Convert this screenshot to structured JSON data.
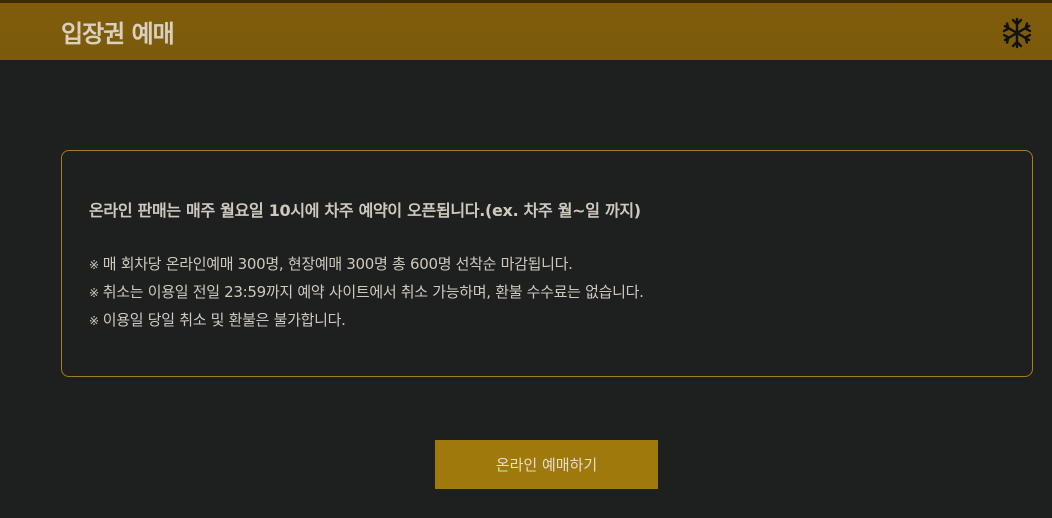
{
  "header": {
    "title": "입장권 예매",
    "icon": "snowflake-icon"
  },
  "notice": {
    "headline": "온라인 판매는 매주 월요일 10시에 차주 예약이 오픈됩니다.(ex. 차주 월~일 까지)",
    "bullet_mark": "※",
    "items": [
      "매 회차당 온라인예매 300명, 현장예매 300명 총 600명 선착순 마감됩니다.",
      "취소는 이용일 전일 23:59까지 예약 사이트에서 취소 가능하며, 환불 수수료는 없습니다.",
      "이용일 당일 취소 및 환불은 불가합니다."
    ]
  },
  "button": {
    "label": "온라인 예매하기"
  },
  "colors": {
    "header_bg": "#7f5d0d",
    "page_bg": "#1e1f1f",
    "accent": "#a0790c",
    "text": "#cfc8bd"
  }
}
